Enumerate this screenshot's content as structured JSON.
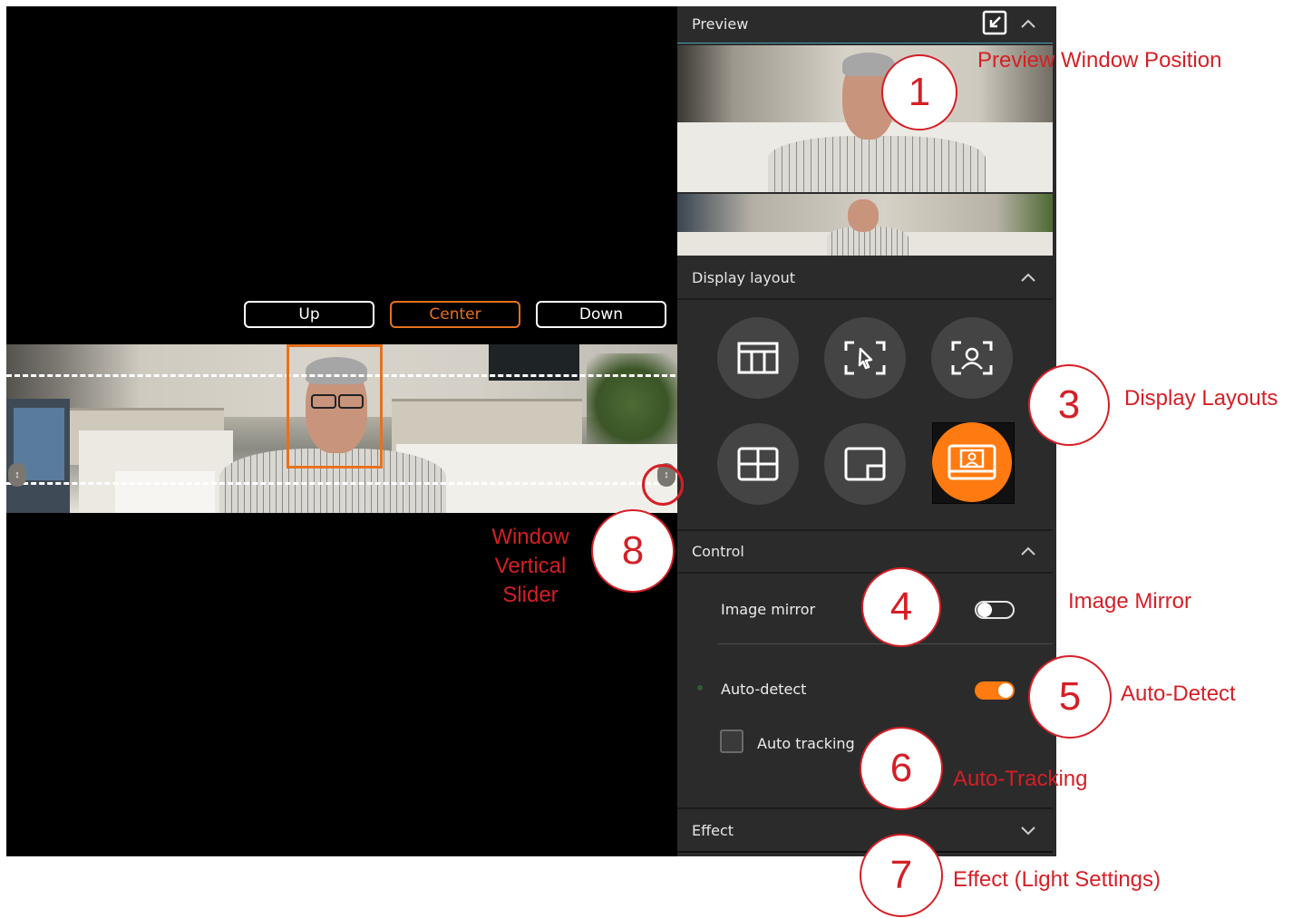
{
  "preview": {
    "title": "Preview",
    "minimize_icon": "minimize-window-icon",
    "collapse_icon": "chevron-up-icon"
  },
  "position_buttons": {
    "up": "Up",
    "center": "Center",
    "down": "Down",
    "active": "center"
  },
  "display_layout": {
    "title": "Display layout",
    "collapse_icon": "chevron-up-icon",
    "layouts": [
      {
        "icon": "panorama-layout-icon"
      },
      {
        "icon": "manual-select-layout-icon"
      },
      {
        "icon": "speaker-focus-layout-icon"
      },
      {
        "icon": "grid-layout-icon"
      },
      {
        "icon": "picture-in-picture-layout-icon"
      },
      {
        "icon": "speaker-panorama-layout-icon",
        "selected": true
      }
    ]
  },
  "control": {
    "title": "Control",
    "collapse_icon": "chevron-up-icon",
    "image_mirror": {
      "label": "Image mirror",
      "on": false
    },
    "auto_detect": {
      "label": "Auto-detect",
      "on": true
    },
    "auto_tracking": {
      "label": "Auto tracking",
      "checked": false
    }
  },
  "effect": {
    "title": "Effect",
    "expand_icon": "chevron-down-icon"
  },
  "annotations": {
    "c1": {
      "number": "1",
      "label": "Preview Window Position"
    },
    "c3": {
      "number": "3",
      "label": "Display Layouts"
    },
    "c4": {
      "number": "4",
      "label": "Image Mirror"
    },
    "c5": {
      "number": "5",
      "label": "Auto-Detect"
    },
    "c6": {
      "number": "6",
      "label": "Auto-Tracking"
    },
    "c7": {
      "number": "7",
      "label": "Effect (Light Settings)"
    },
    "c8": {
      "number": "8",
      "label_lines": [
        "Window",
        "Vertical",
        "Slider"
      ]
    }
  },
  "colors": {
    "accent": "#ff7a10",
    "annotation": "#d51f26",
    "panel_bg": "#2b2b2b"
  }
}
